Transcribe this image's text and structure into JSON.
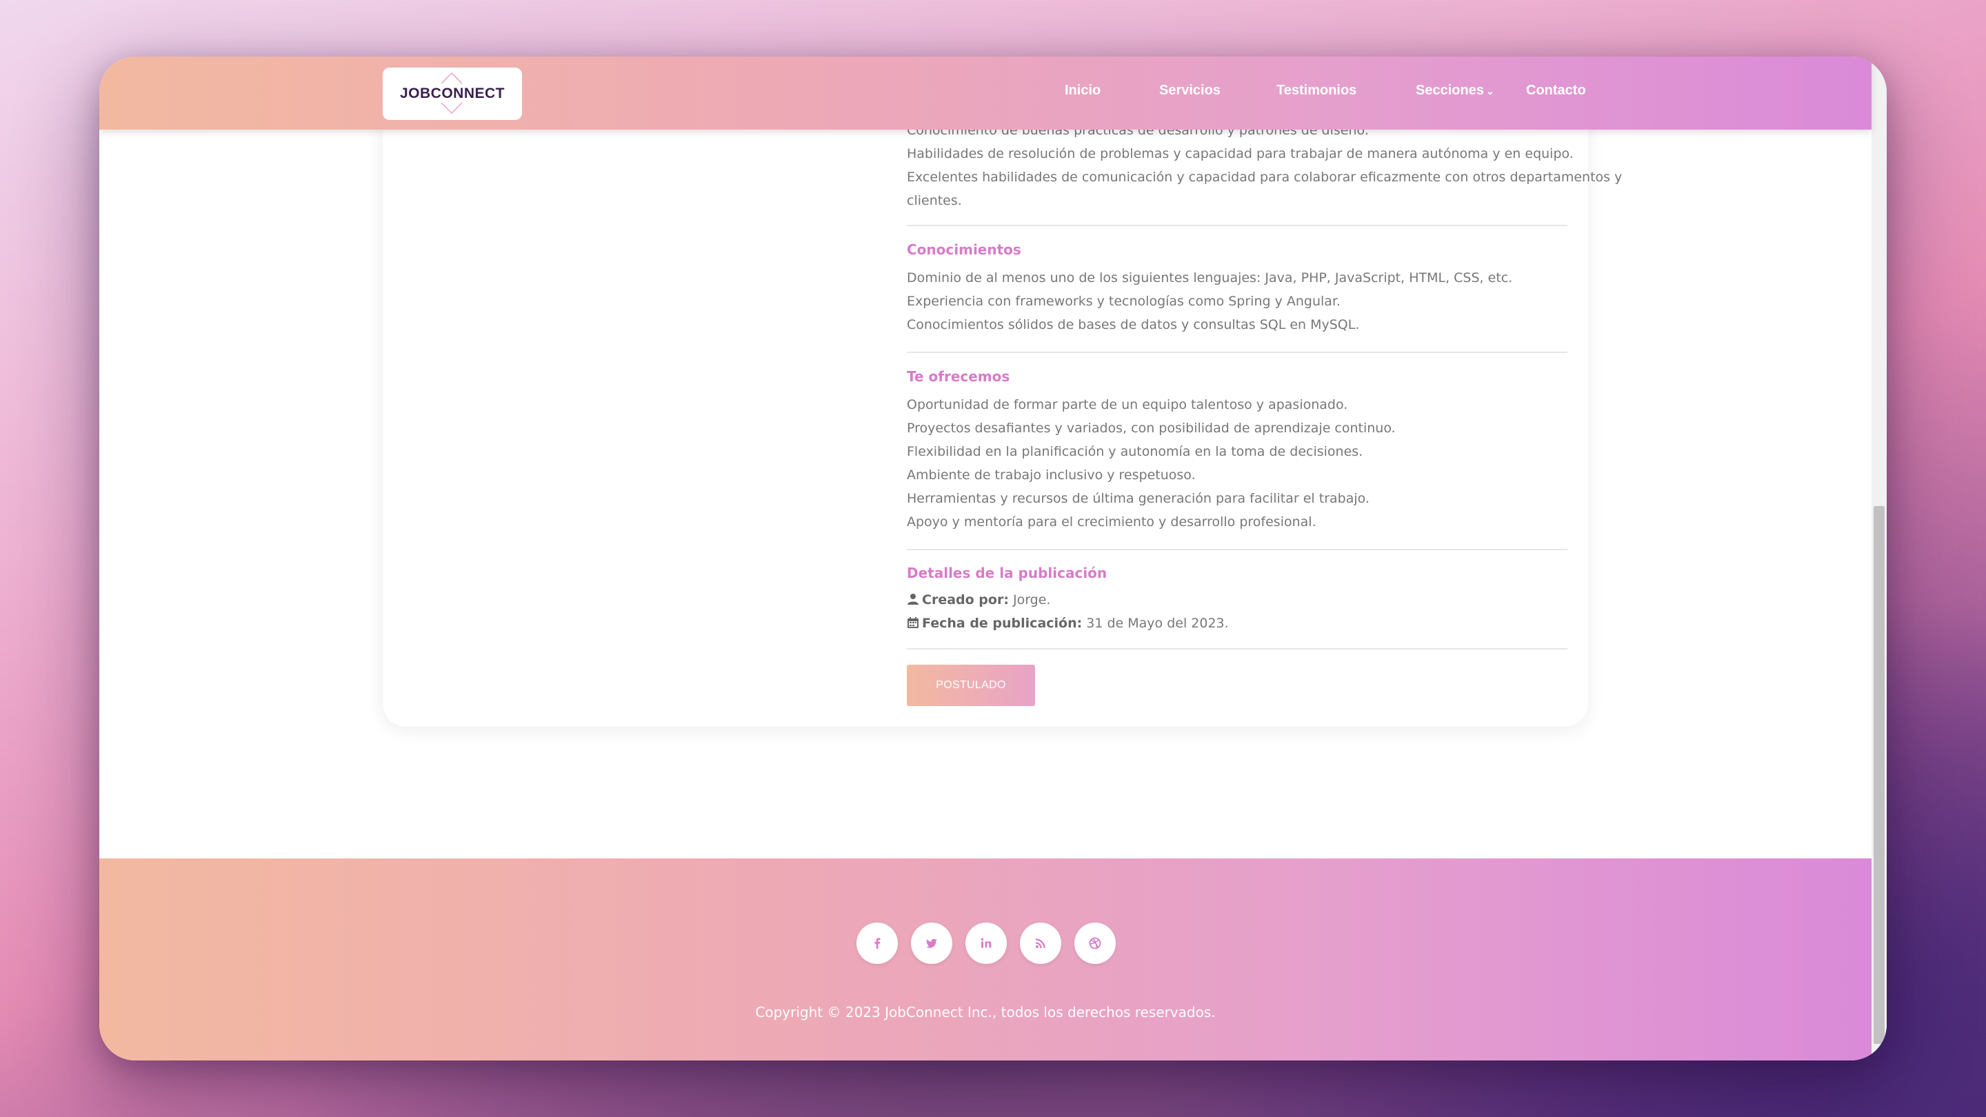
{
  "navbar": {
    "logo_text": "JOBCONNECT",
    "items": [
      {
        "label": "Inicio"
      },
      {
        "label": "Servicios"
      },
      {
        "label": "Testimonios"
      },
      {
        "label": "Secciones",
        "caret": "⌄"
      },
      {
        "label": "Contacto"
      }
    ]
  },
  "requirements": {
    "cut_line": "Conocimiento de buenas prácticas de desarrollo y patrones de diseño.",
    "lines": [
      "Habilidades de resolución de problemas y capacidad para trabajar de manera autónoma y en equipo.",
      "Excelentes habilidades de comunicación y capacidad para colaborar eficazmente con otros departamentos y",
      "clientes."
    ]
  },
  "knowledge": {
    "heading": "Conocimientos",
    "lines": [
      "Dominio de al menos uno de los siguientes lenguajes: Java, PHP, JavaScript, HTML, CSS, etc.",
      "Experiencia con frameworks y tecnologías como Spring y Angular.",
      "Conocimientos sólidos de bases de datos y consultas SQL en MySQL."
    ]
  },
  "offer": {
    "heading": "Te ofrecemos",
    "lines": [
      "Oportunidad de formar parte de un equipo talentoso y apasionado.",
      "Proyectos desafiantes y variados, con posibilidad de aprendizaje continuo.",
      "Flexibilidad en la planificación y autonomía en la toma de decisiones.",
      "Ambiente de trabajo inclusivo y respetuoso.",
      "Herramientas y recursos de última generación para facilitar el trabajo.",
      "Apoyo y mentoría para el crecimiento y desarrollo profesional."
    ]
  },
  "details": {
    "heading": "Detalles de la publicación",
    "created_by_label": "Creado por:",
    "created_by_value": " Jorge.",
    "date_label": "Fecha de publicación:",
    "date_value": " 31 de Mayo del 2023.",
    "icons": [
      "user-icon",
      "calendar-icon"
    ]
  },
  "apply_button": {
    "label": "POSTULADO"
  },
  "footer": {
    "social_icons": [
      "facebook-icon",
      "twitter-icon",
      "linkedin-icon",
      "rss-icon",
      "dribbble-icon"
    ],
    "copyright": "Copyright © 2023 JobConnect Inc., todos los derechos reservados."
  },
  "colors": {
    "accent": "#d77bc9",
    "gradient_start": "#f3b9a0",
    "gradient_end": "#da8ad8"
  }
}
